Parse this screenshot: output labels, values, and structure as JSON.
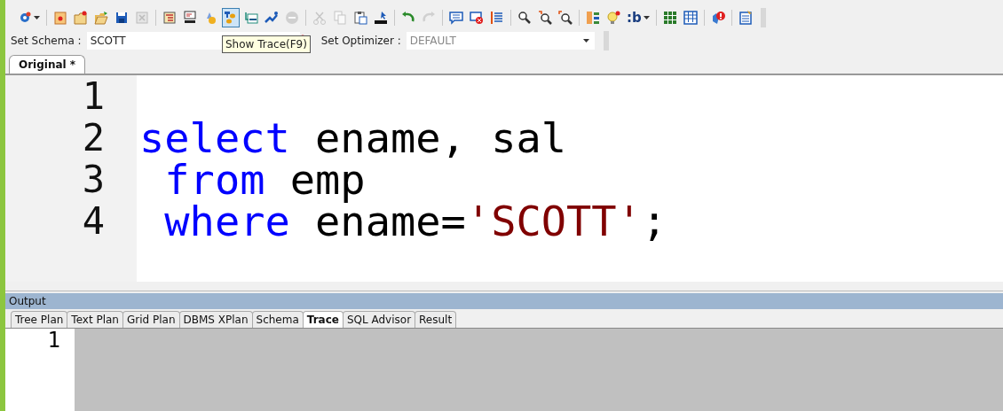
{
  "toolbar": [
    {
      "kind": "icon",
      "dropdown": true,
      "selected": false,
      "disabled": false
    },
    {
      "kind": "separator"
    },
    {
      "kind": "icon",
      "selected": false,
      "disabled": false
    },
    {
      "kind": "icon",
      "selected": false,
      "disabled": false
    },
    {
      "kind": "icon",
      "selected": false,
      "disabled": false
    },
    {
      "kind": "icon",
      "selected": false,
      "disabled": false
    },
    {
      "kind": "icon",
      "selected": false,
      "disabled": true
    },
    {
      "kind": "separator"
    },
    {
      "kind": "icon",
      "selected": false,
      "disabled": false
    },
    {
      "kind": "icon",
      "selected": false,
      "disabled": false
    },
    {
      "kind": "icon",
      "selected": false,
      "disabled": false
    },
    {
      "kind": "icon",
      "selected": true,
      "disabled": false
    },
    {
      "kind": "icon",
      "selected": false,
      "disabled": false
    },
    {
      "kind": "icon",
      "selected": false,
      "disabled": false
    },
    {
      "kind": "icon",
      "selected": false,
      "disabled": true
    },
    {
      "kind": "separator"
    },
    {
      "kind": "icon",
      "selected": false,
      "disabled": true
    },
    {
      "kind": "icon",
      "selected": false,
      "disabled": true
    },
    {
      "kind": "icon",
      "selected": false,
      "disabled": false
    },
    {
      "kind": "icon",
      "selected": false,
      "disabled": false
    },
    {
      "kind": "separator"
    },
    {
      "kind": "icon",
      "selected": false,
      "disabled": false
    },
    {
      "kind": "icon",
      "selected": false,
      "disabled": true
    },
    {
      "kind": "separator"
    },
    {
      "kind": "icon",
      "selected": false,
      "disabled": false
    },
    {
      "kind": "icon",
      "selected": false,
      "disabled": false
    },
    {
      "kind": "icon",
      "selected": false,
      "disabled": false
    },
    {
      "kind": "separator"
    },
    {
      "kind": "icon",
      "selected": false,
      "disabled": false
    },
    {
      "kind": "icon",
      "selected": false,
      "disabled": false
    },
    {
      "kind": "icon",
      "selected": false,
      "disabled": false
    },
    {
      "kind": "separator"
    },
    {
      "kind": "icon",
      "selected": false,
      "disabled": false
    },
    {
      "kind": "icon",
      "selected": false,
      "disabled": false
    },
    {
      "kind": "text",
      "label": ":b",
      "dropdown": true,
      "selected": false,
      "disabled": false
    },
    {
      "kind": "separator"
    },
    {
      "kind": "icon",
      "selected": false,
      "disabled": false
    },
    {
      "kind": "icon",
      "selected": false,
      "disabled": false
    },
    {
      "kind": "separator"
    },
    {
      "kind": "icon",
      "selected": false,
      "disabled": false
    },
    {
      "kind": "separator"
    },
    {
      "kind": "icon",
      "selected": false,
      "disabled": false
    }
  ],
  "schema": {
    "label": "Set Schema :",
    "value": "SCOTT"
  },
  "tooltip": "Show Trace(F9)",
  "optimizer": {
    "label": "Set Optimizer :",
    "value": "DEFAULT"
  },
  "editor_tabs": [
    {
      "label": "Original *",
      "selected": true
    }
  ],
  "editor": {
    "lines": [
      {
        "number": "1"
      },
      {
        "number": "2",
        "tokens": [
          {
            "text": "select",
            "kind": "keyword"
          },
          {
            "text": " ename, sal",
            "kind": "plain"
          }
        ]
      },
      {
        "number": "3",
        "tokens": [
          {
            "text": " from",
            "kind": "keyword"
          },
          {
            "text": " emp",
            "kind": "plain"
          }
        ]
      },
      {
        "number": "4",
        "tokens": [
          {
            "text": " where",
            "kind": "keyword"
          },
          {
            "text": " ename=",
            "kind": "plain"
          },
          {
            "text": "'SCOTT'",
            "kind": "string"
          },
          {
            "text": ";",
            "kind": "plain"
          }
        ]
      }
    ]
  },
  "output": {
    "title": "Output",
    "tabs": [
      {
        "label": "Tree Plan",
        "selected": false
      },
      {
        "label": "Text Plan",
        "selected": false
      },
      {
        "label": "Grid Plan",
        "selected": false
      },
      {
        "label": "DBMS XPlan",
        "selected": false
      },
      {
        "label": "Schema",
        "selected": false
      },
      {
        "label": "Trace",
        "selected": true
      },
      {
        "label": "SQL Advisor",
        "selected": false
      },
      {
        "label": "Result",
        "selected": false
      }
    ],
    "lines": [
      "1"
    ]
  }
}
